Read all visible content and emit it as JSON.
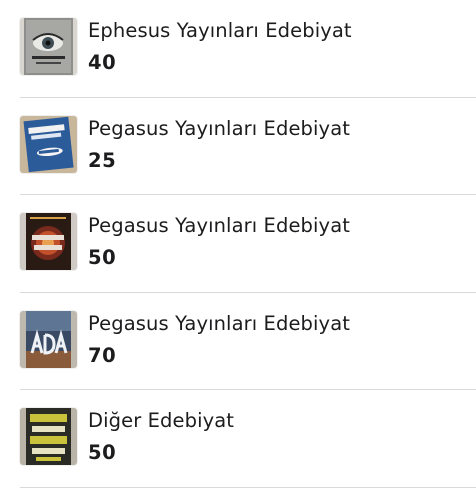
{
  "listings": [
    {
      "title": "Ephesus Yayınları Edebiyat",
      "price": "40",
      "cover_icon": "book-cover-eye-thumbnail",
      "cover_color": "#8e8f8c"
    },
    {
      "title": "Pegasus Yayınları Edebiyat",
      "price": "25",
      "cover_icon": "book-cover-blue-thumbnail",
      "cover_color": "#2c5b9a"
    },
    {
      "title": "Pegasus Yayınları Edebiyat",
      "price": "50",
      "cover_icon": "book-cover-red-circle-thumbnail",
      "cover_color": "#7a2a1c"
    },
    {
      "title": "Pegasus Yayınları Edebiyat",
      "price": "70",
      "cover_icon": "book-cover-ada-thumbnail",
      "cover_color": "#3a4a64"
    },
    {
      "title": "Diğer Edebiyat",
      "price": "50",
      "cover_icon": "book-cover-yellow-thumbnail",
      "cover_color": "#c9c23a"
    }
  ]
}
